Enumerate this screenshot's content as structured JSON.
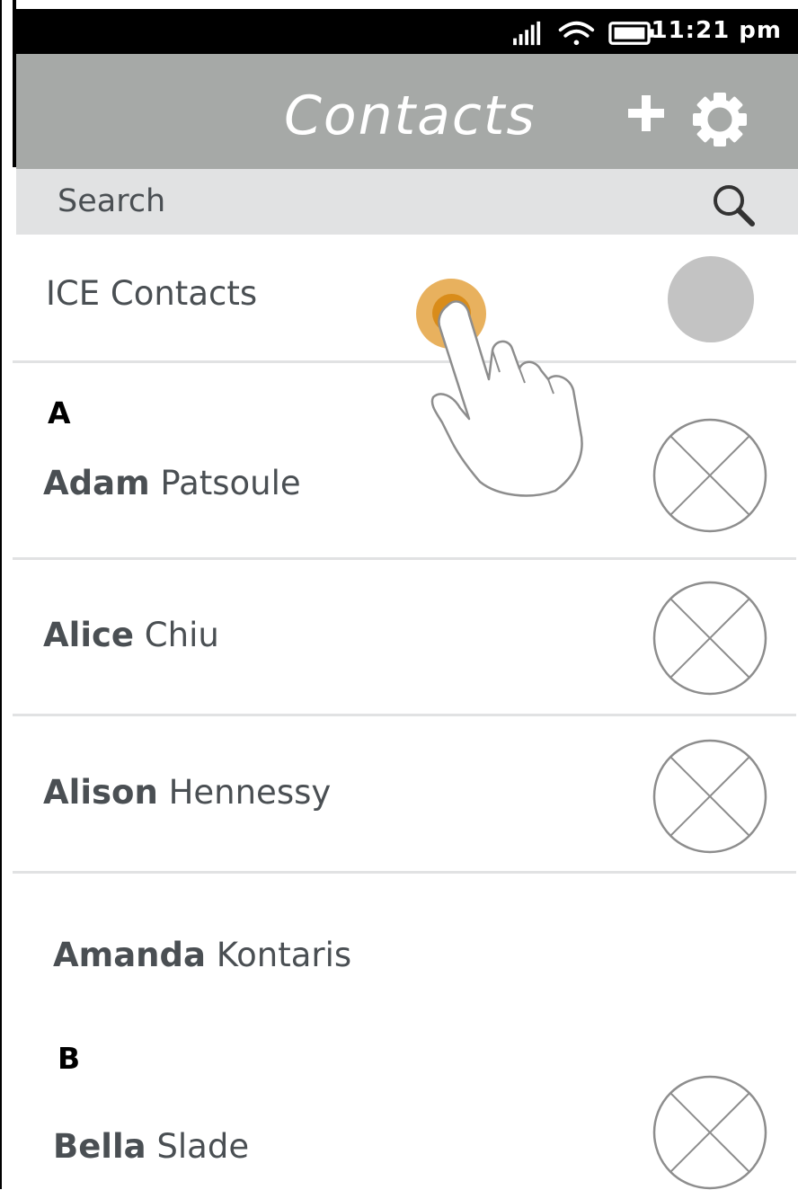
{
  "status_bar": {
    "time": "11:21 pm"
  },
  "header": {
    "title": "Contacts",
    "add_icon": "plus-icon",
    "settings_icon": "gear-icon"
  },
  "search": {
    "placeholder": "Search",
    "icon": "search-icon"
  },
  "ice": {
    "label": "ICE Contacts"
  },
  "sections": [
    {
      "letter": "A"
    },
    {
      "letter": "B"
    }
  ],
  "contacts": [
    {
      "first": "Adam",
      "last": "Patsoule"
    },
    {
      "first": "Alice",
      "last": "Chiu"
    },
    {
      "first": "Alison",
      "last": "Hennessy"
    },
    {
      "first": "Amanda",
      "last": "Kontaris"
    },
    {
      "first": "Bella",
      "last": "Slade"
    }
  ],
  "colors": {
    "header_bg": "#a6a9a7",
    "search_bg": "#e1e2e3",
    "text": "#4a4f53",
    "touch_indicator": "#e8b15e"
  }
}
